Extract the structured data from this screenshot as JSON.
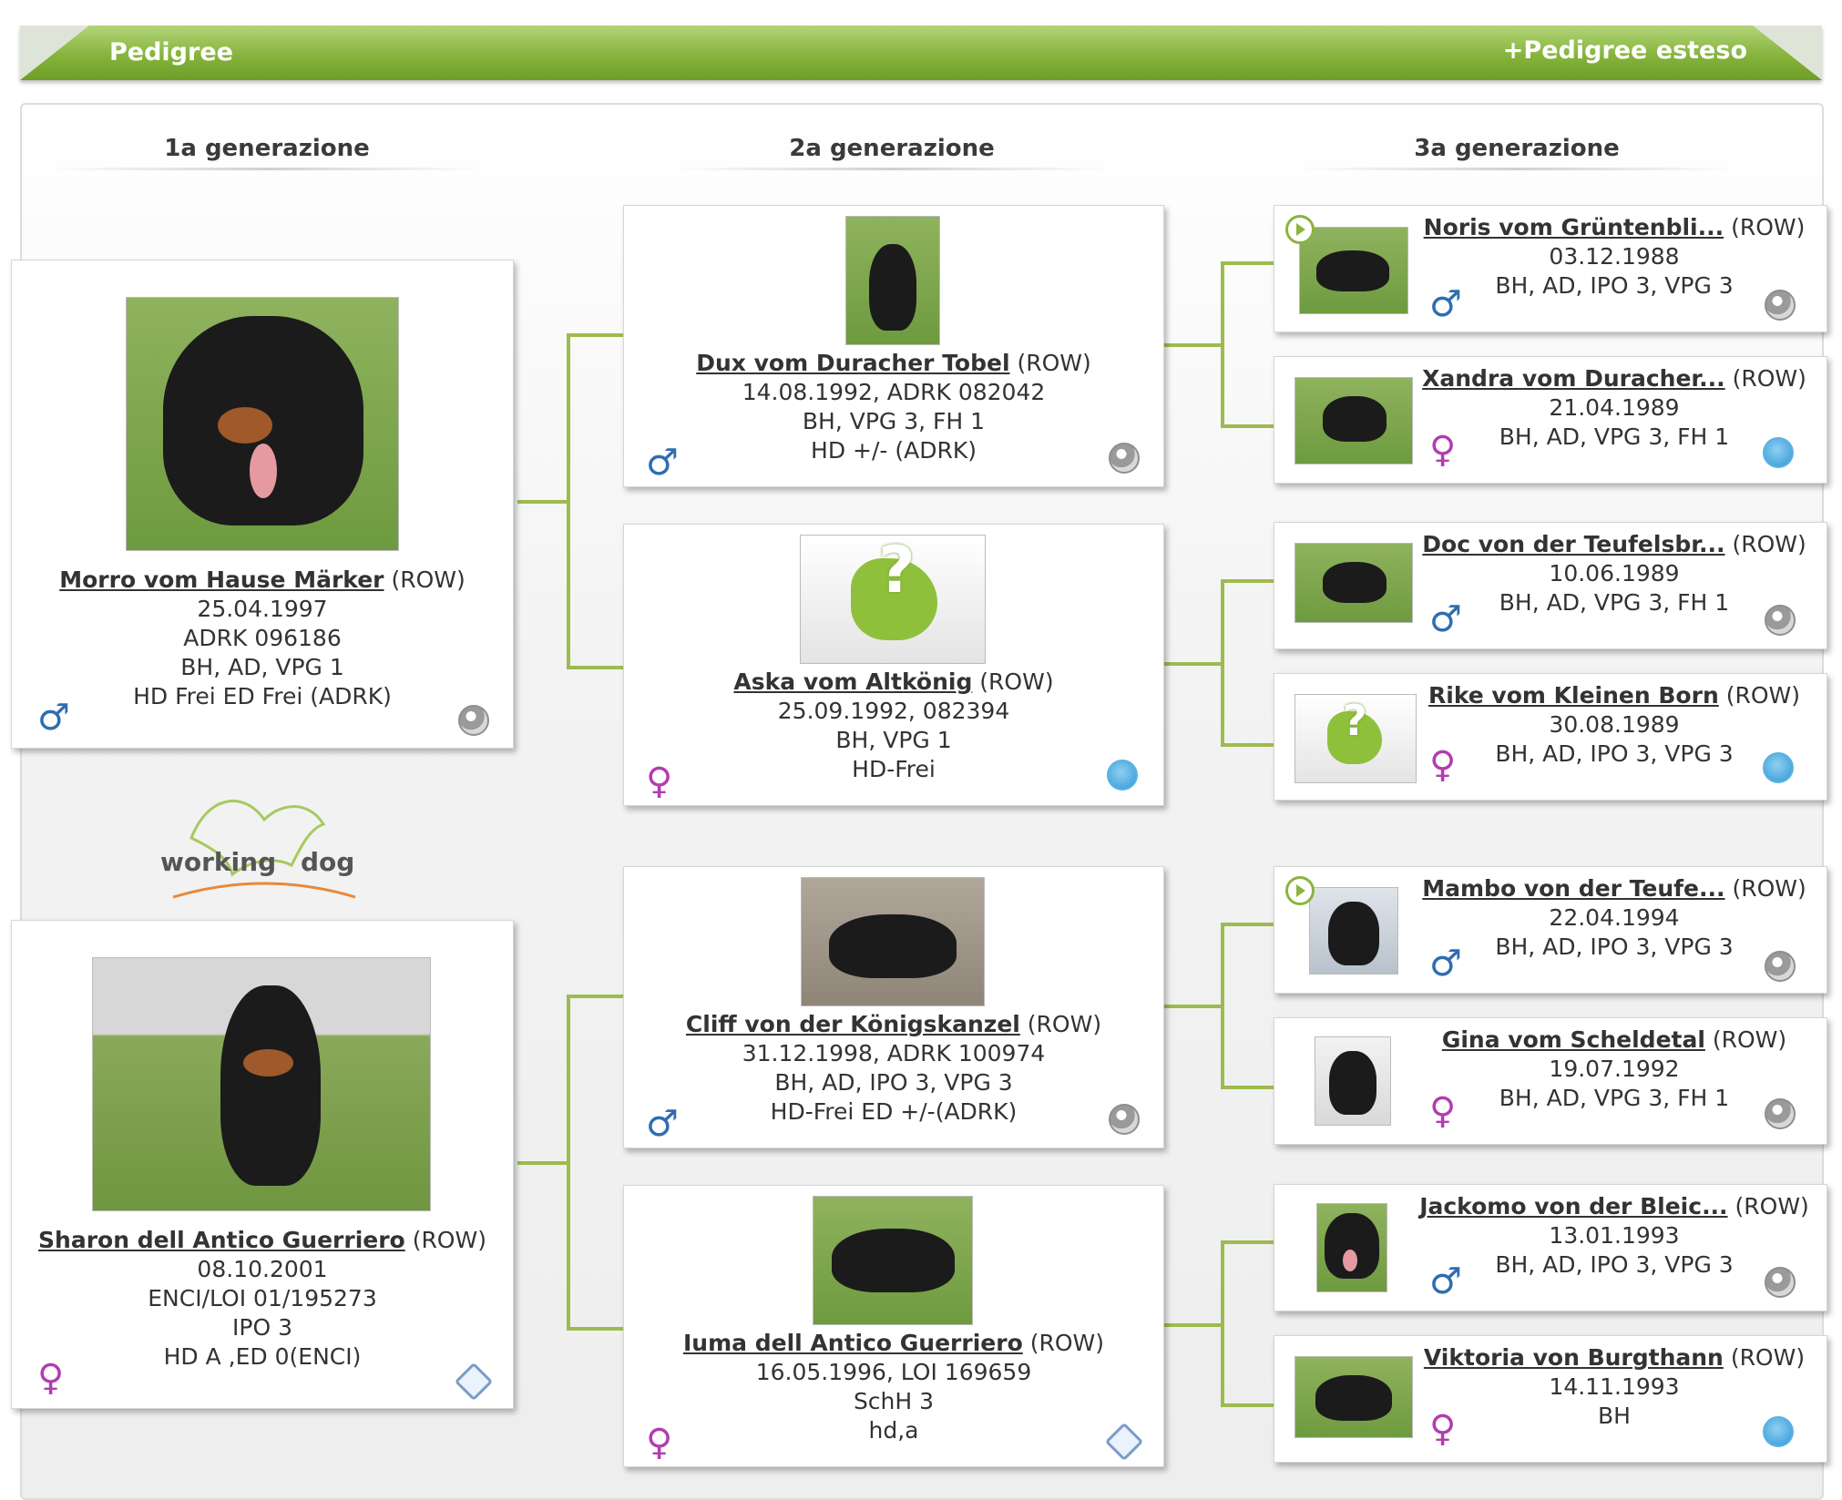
{
  "header": {
    "title": "Pedigree",
    "extended_link": "+Pedigree esteso"
  },
  "generations": [
    "1a generazione",
    "2a generazione",
    "3a generazione"
  ],
  "logo": {
    "word1": "working",
    "word2": "dog"
  },
  "gen1": [
    {
      "name": "Morro vom Hause Märker",
      "breed": "(ROW)",
      "lines": [
        "25.04.1997",
        "ADRK 096186",
        "BH, AD, VPG 1",
        "HD Frei ED Frei (ADRK)"
      ],
      "sex": "male",
      "badge": "grey"
    },
    {
      "name": "Sharon dell Antico Guerriero",
      "breed": "(ROW)",
      "lines": [
        "08.10.2001",
        "ENCI/LOI 01/195273",
        "IPO 3",
        "HD A ,ED 0(ENCI)"
      ],
      "sex": "female",
      "badge": "enci"
    }
  ],
  "gen2": [
    {
      "name": "Dux vom Duracher Tobel",
      "breed": "(ROW)",
      "lines": [
        "14.08.1992, ADRK 082042",
        "BH, VPG 3, FH 1",
        "HD +/- (ADRK)"
      ],
      "sex": "male",
      "badge": "grey"
    },
    {
      "name": "Aska vom Altkönig",
      "breed": "(ROW)",
      "lines": [
        "25.09.1992, 082394",
        "BH, VPG 1",
        "HD-Frei"
      ],
      "sex": "female",
      "badge": "fci"
    },
    {
      "name": "Cliff von der Königskanzel",
      "breed": "(ROW)",
      "lines": [
        "31.12.1998, ADRK 100974",
        "BH, AD, IPO 3, VPG 3",
        "HD-Frei ED +/-(ADRK)"
      ],
      "sex": "male",
      "badge": "grey"
    },
    {
      "name": "Iuma dell Antico Guerriero",
      "breed": "(ROW)",
      "lines": [
        "16.05.1996, LOI 169659",
        "SchH 3",
        "hd,a"
      ],
      "sex": "female",
      "badge": "enci"
    }
  ],
  "gen3": [
    {
      "name": "Noris vom Grüntenbli...",
      "breed": "(ROW)",
      "lines": [
        "03.12.1988",
        "BH, AD, IPO 3, VPG 3"
      ],
      "sex": "male",
      "badge": "grey",
      "video": true
    },
    {
      "name": "Xandra vom Duracher...",
      "breed": "(ROW)",
      "lines": [
        "21.04.1989",
        "BH, AD, VPG 3, FH 1"
      ],
      "sex": "female",
      "badge": "fci",
      "video": false
    },
    {
      "name": "Doc von der Teufelsbr...",
      "breed": "(ROW)",
      "lines": [
        "10.06.1989",
        "BH, AD, VPG 3, FH 1"
      ],
      "sex": "male",
      "badge": "grey",
      "video": false
    },
    {
      "name": "Rike vom Kleinen Born",
      "breed": "(ROW)",
      "lines": [
        "30.08.1989",
        "BH, AD, IPO 3, VPG 3"
      ],
      "sex": "female",
      "badge": "fci",
      "video": false
    },
    {
      "name": "Mambo von der Teufe...",
      "breed": "(ROW)",
      "lines": [
        "22.04.1994",
        "BH, AD, IPO 3, VPG 3"
      ],
      "sex": "male",
      "badge": "grey",
      "video": true
    },
    {
      "name": "Gina vom Scheldetal",
      "breed": "(ROW)",
      "lines": [
        "19.07.1992",
        "BH, AD, VPG 3, FH 1"
      ],
      "sex": "female",
      "badge": "grey",
      "video": false
    },
    {
      "name": "Jackomo von der Bleic...",
      "breed": "(ROW)",
      "lines": [
        "13.01.1993",
        "BH, AD, IPO 3, VPG 3"
      ],
      "sex": "male",
      "badge": "grey",
      "video": false
    },
    {
      "name": "Viktoria von Burgthann",
      "breed": "(ROW)",
      "lines": [
        "14.11.1993",
        "BH"
      ],
      "sex": "female",
      "badge": "fci",
      "video": false
    }
  ],
  "symbols": {
    "male": "♂",
    "female": "♀"
  },
  "colors": {
    "accent_green": "#86b43c",
    "male": "#2f6db0",
    "female": "#b23cb0",
    "connector": "#9dbb4f"
  }
}
